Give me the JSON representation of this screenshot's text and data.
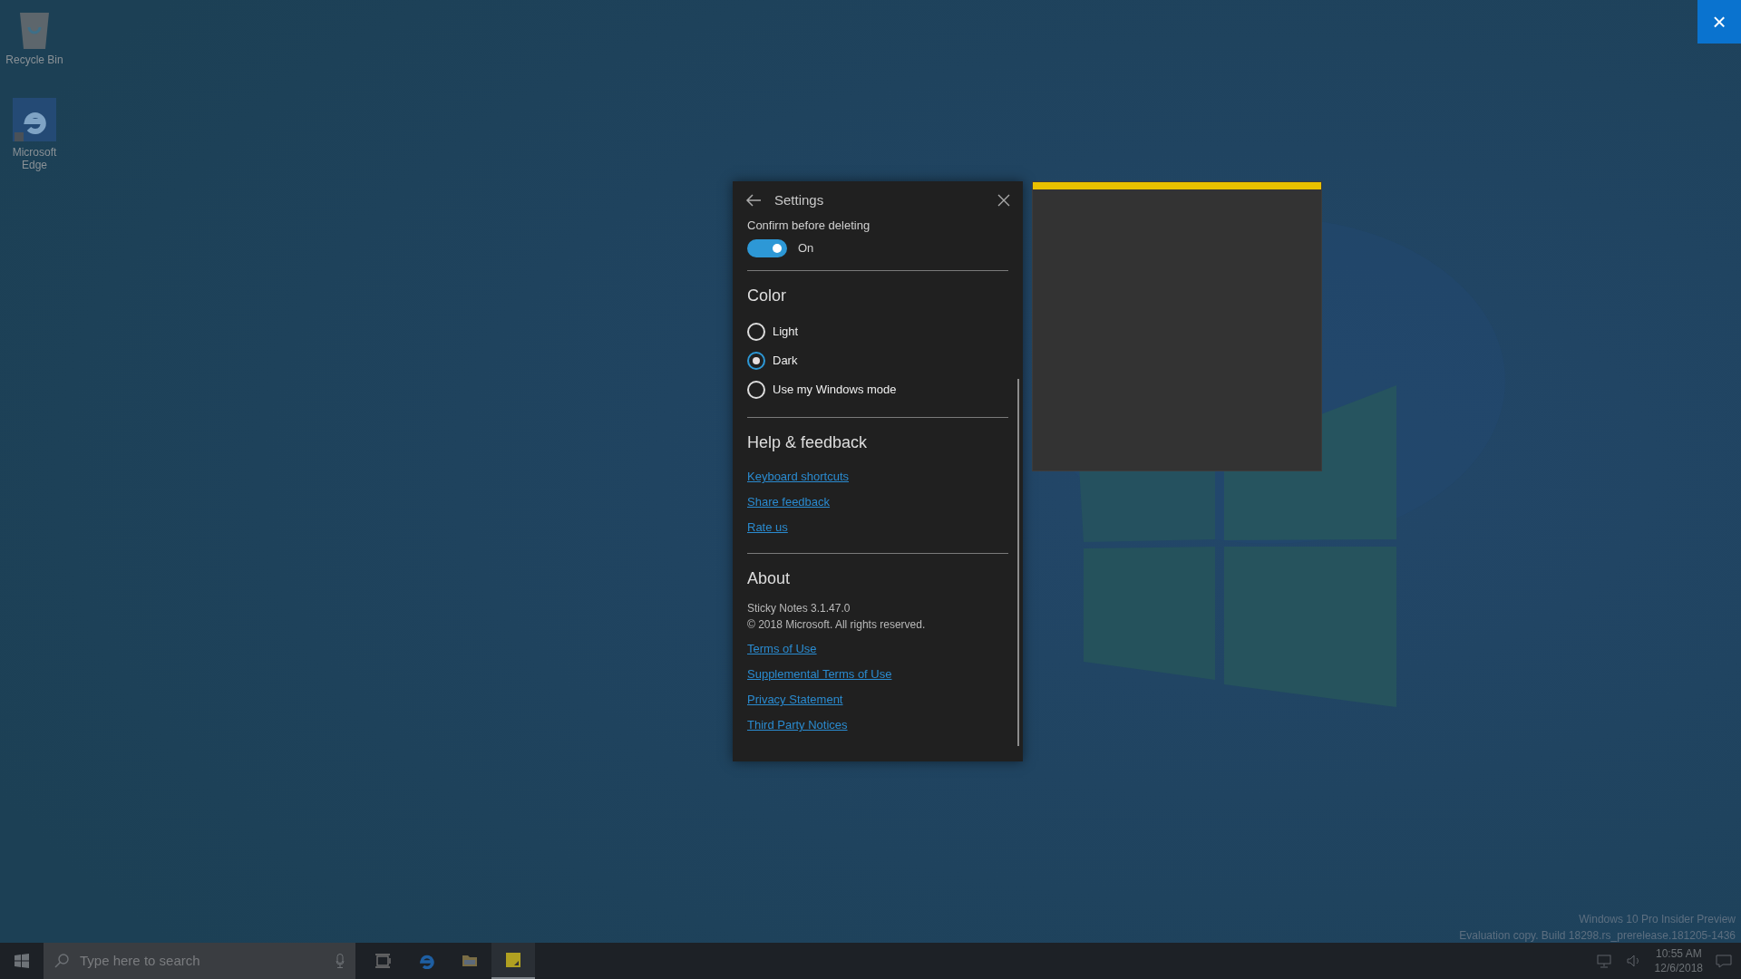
{
  "desktop_icons": [
    {
      "kind": "recycle",
      "label": "Recycle Bin"
    },
    {
      "kind": "browser",
      "label": "Microsoft Edge"
    }
  ],
  "overlay_close": {
    "label": "×"
  },
  "settings": {
    "title": "Settings",
    "confirm": {
      "label": "Confirm before deleting",
      "on": true,
      "state_text": "On"
    },
    "color": {
      "heading": "Color",
      "options": [
        {
          "label": "Light",
          "selected": false
        },
        {
          "label": "Dark",
          "selected": true
        },
        {
          "label": "Use my Windows mode",
          "selected": false
        }
      ]
    },
    "help": {
      "heading": "Help & feedback",
      "links": [
        "Keyboard shortcuts",
        "Share feedback",
        "Rate us"
      ]
    },
    "about": {
      "heading": "About",
      "lines": [
        "Sticky Notes 3.1.47.0",
        "© 2018 Microsoft. All rights reserved."
      ],
      "links": [
        "Terms of Use",
        "Supplemental Terms of Use",
        "Privacy Statement",
        "Third Party Notices"
      ]
    }
  },
  "build_info": [
    "Windows 10 Pro Insider Preview",
    "Evaluation copy. Build 18298.rs_prerelease.181205-1436"
  ],
  "taskbar": {
    "search_placeholder": "Type here to search",
    "apps": [
      {
        "kind": "taskview",
        "active": false
      },
      {
        "kind": "browser",
        "active": false
      },
      {
        "kind": "folder",
        "active": false
      },
      {
        "kind": "notes",
        "active": true
      }
    ],
    "clock": {
      "time": "10:55 AM",
      "date": "12/6/2018"
    }
  }
}
